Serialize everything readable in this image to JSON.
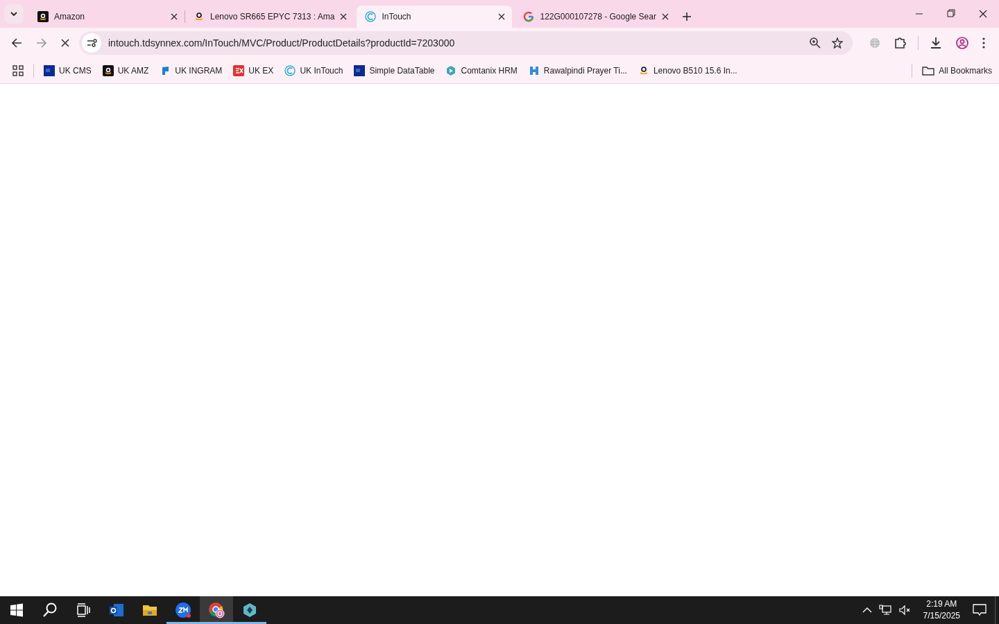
{
  "tabs": [
    {
      "title": "Amazon",
      "kind": "amazon",
      "selected": false
    },
    {
      "title": "Lenovo SR665 EPYC 7313 : Ama",
      "kind": "smile",
      "selected": false
    },
    {
      "title": "InTouch",
      "kind": "intouch",
      "selected": true
    },
    {
      "title": "122G000107278 - Google Sear",
      "kind": "google",
      "selected": false
    }
  ],
  "address_bar": {
    "url": "intouch.tdsynnex.com/InTouch/MVC/Product/ProductDetails?productId=7203000",
    "loading": true
  },
  "bookmarks": [
    {
      "label": "UK CMS",
      "kind": "df"
    },
    {
      "label": "UK AMZ",
      "kind": "amazon"
    },
    {
      "label": "UK INGRAM",
      "kind": "ingram"
    },
    {
      "label": "UK EX",
      "kind": "ex"
    },
    {
      "label": "UK InTouch",
      "kind": "intouch"
    },
    {
      "label": "Simple DataTable",
      "kind": "df"
    },
    {
      "label": "Comtanix HRM",
      "kind": "hex"
    },
    {
      "label": "Rawalpindi Prayer Ti...",
      "kind": "h"
    },
    {
      "label": "Lenovo B510 15.6 In...",
      "kind": "smile"
    }
  ],
  "all_bookmarks": "All Bookmarks",
  "taskbar": {
    "apps": [
      {
        "kind": "outlook",
        "running": false,
        "selected": false
      },
      {
        "kind": "explorer",
        "running": false,
        "selected": false
      },
      {
        "kind": "zoom",
        "running": true,
        "selected": false
      },
      {
        "kind": "chrome",
        "running": true,
        "selected": true
      },
      {
        "kind": "gem",
        "running": true,
        "selected": false
      }
    ],
    "time": "2:19 AM",
    "date": "7/15/2025"
  }
}
